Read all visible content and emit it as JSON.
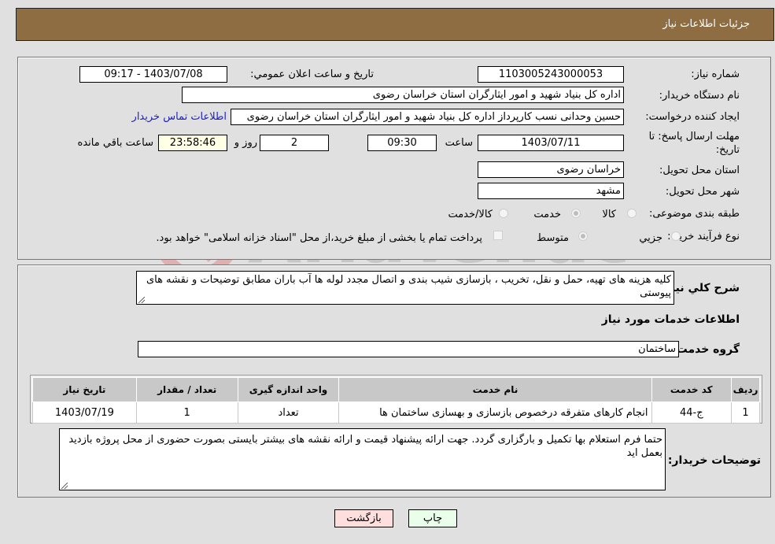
{
  "header": {
    "title": "جزئیات اطلاعات نیاز"
  },
  "watermark": {
    "text": "AriaTender.neT"
  },
  "details": {
    "need_number_label": "شماره نیاز:",
    "need_number": "1103005243000053",
    "announce_label": "تاریخ و ساعت اعلان عمومي:",
    "announce_value": "1403/07/08 - 09:17",
    "buyer_org_label": "نام دستگاه خریدار:",
    "buyer_org": "اداره کل بنیاد شهید و امور ایثارگران استان خراسان رضوی",
    "creator_label": "ایجاد کننده درخواست:",
    "creator": "حسین وحدانی نسب کارپرداز اداره کل بنیاد شهید و امور ایثارگران استان خراسان رضوی",
    "contact_link": "اطلاعات تماس خریدار",
    "deadline_label": "مهلت ارسال پاسخ: تا تاریخ:",
    "deadline_date": "1403/07/11",
    "time_label": "ساعت",
    "deadline_time": "09:30",
    "days_value": "2",
    "days_label": "روز و",
    "remaining_time": "23:58:46",
    "remaining_label": "ساعت باقي مانده",
    "province_label": "استان محل تحویل:",
    "province": "خراسان رضوی",
    "city_label": "شهر محل تحویل:",
    "city": "مشهد",
    "category_label": "طبقه بندی موضوعی:",
    "category_options": [
      {
        "label": "کالا",
        "checked": false
      },
      {
        "label": "خدمت",
        "checked": true
      },
      {
        "label": "کالا/خدمت",
        "checked": false
      }
    ],
    "process_label": "نوع فرآیند خرید :",
    "process_options": [
      {
        "label": "جزيي",
        "checked": false
      },
      {
        "label": "متوسط",
        "checked": true
      }
    ],
    "treasury_note": "پرداخت تمام یا بخشی از مبلغ خرید،از محل \"اسناد خزانه اسلامی\" خواهد بود.",
    "treasury_checked": false
  },
  "services": {
    "description_label": "شرح کلي نياز:",
    "description": "کلیه هزینه های تهیه، حمل و نقل، تخریب ، بازسازی شیب بندی و اتصال مجدد لوله ها آب باران مطابق توضیحات و نقشه های پیوستی",
    "section_title": "اطلاعات خدمات مورد نياز",
    "group_label": "گروه خدمت:",
    "group_value": "ساختمان",
    "table": {
      "headers": [
        "رديف",
        "کد خدمت",
        "نام خدمت",
        "واحد اندازه گیری",
        "تعداد / مقدار",
        "تاریخ نیاز"
      ],
      "rows": [
        [
          "1",
          "ج-44",
          "انجام کارهای متفرقه درخصوص بازسازی و بهسازی ساختمان ها",
          "تعداد",
          "1",
          "1403/07/19"
        ]
      ]
    },
    "buyer_notes_label": "توضیحات خریدار:",
    "buyer_notes": "حتما فرم استعلام بها تکمیل و بارگزاری گردد. جهت ارائه پیشنهاد قیمت و ارائه نقشه های بیشتر بایستی بصورت حضوری از محل پروژه بازدید بعمل اید"
  },
  "buttons": {
    "print": "چاپ",
    "back": "بازگشت"
  },
  "colors": {
    "header": "#8f6d42",
    "print_bg": "#eaffea",
    "back_bg": "#ffdede",
    "link": "#2020c0"
  }
}
